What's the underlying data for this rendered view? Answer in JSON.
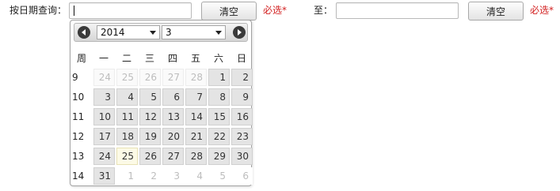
{
  "form": {
    "from_label": "按日期查询：",
    "clear_button": "清空",
    "required": "必选*",
    "to_label": "至：",
    "from_value": "",
    "to_value": ""
  },
  "calendar": {
    "year": "2014",
    "month": "3",
    "week_header": "周",
    "weekdays": [
      "一",
      "二",
      "三",
      "四",
      "五",
      "六",
      "日"
    ],
    "weeks": [
      {
        "num": "9",
        "days": [
          "24",
          "25",
          "26",
          "27",
          "28",
          "1",
          "2"
        ]
      },
      {
        "num": "10",
        "days": [
          "3",
          "4",
          "5",
          "6",
          "7",
          "8",
          "9"
        ]
      },
      {
        "num": "11",
        "days": [
          "10",
          "11",
          "12",
          "13",
          "14",
          "15",
          "16"
        ]
      },
      {
        "num": "12",
        "days": [
          "17",
          "18",
          "19",
          "20",
          "21",
          "22",
          "23"
        ]
      },
      {
        "num": "13",
        "days": [
          "24",
          "25",
          "26",
          "27",
          "28",
          "29",
          "30"
        ]
      },
      {
        "num": "14",
        "days": [
          "31",
          "1",
          "2",
          "3",
          "4",
          "5",
          "6"
        ]
      }
    ],
    "today": "25",
    "colors": {
      "required": "#d21e1e",
      "today_bg": "#fcfae6"
    }
  }
}
